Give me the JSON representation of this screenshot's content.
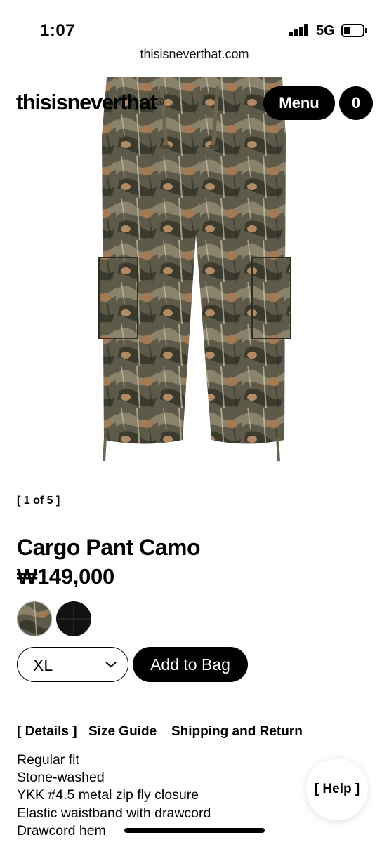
{
  "status_bar": {
    "time": "1:07",
    "network": "5G"
  },
  "browser": {
    "url": "thisisneverthat.com"
  },
  "header": {
    "logo": "thisisneverthat",
    "logo_mark": "®",
    "menu_label": "Menu",
    "cart_count": "0"
  },
  "gallery": {
    "counter": "[ 1 of 5 ]"
  },
  "product": {
    "title": "Cargo Pant Camo",
    "price": "₩149,000"
  },
  "colors": {
    "accent": "#000000",
    "background": "#ffffff"
  },
  "purchase": {
    "size_value": "XL",
    "add_to_bag_label": "Add to Bag"
  },
  "tabs": [
    {
      "label": "[ Details ]"
    },
    {
      "label": "Size Guide"
    },
    {
      "label": "Shipping and Return"
    }
  ],
  "details": [
    "Regular fit",
    "Stone-washed",
    "YKK #4.5 metal zip fly closure",
    "Elastic waistband with drawcord",
    "Drawcord hem"
  ],
  "help": {
    "label": "[ Help ]"
  }
}
